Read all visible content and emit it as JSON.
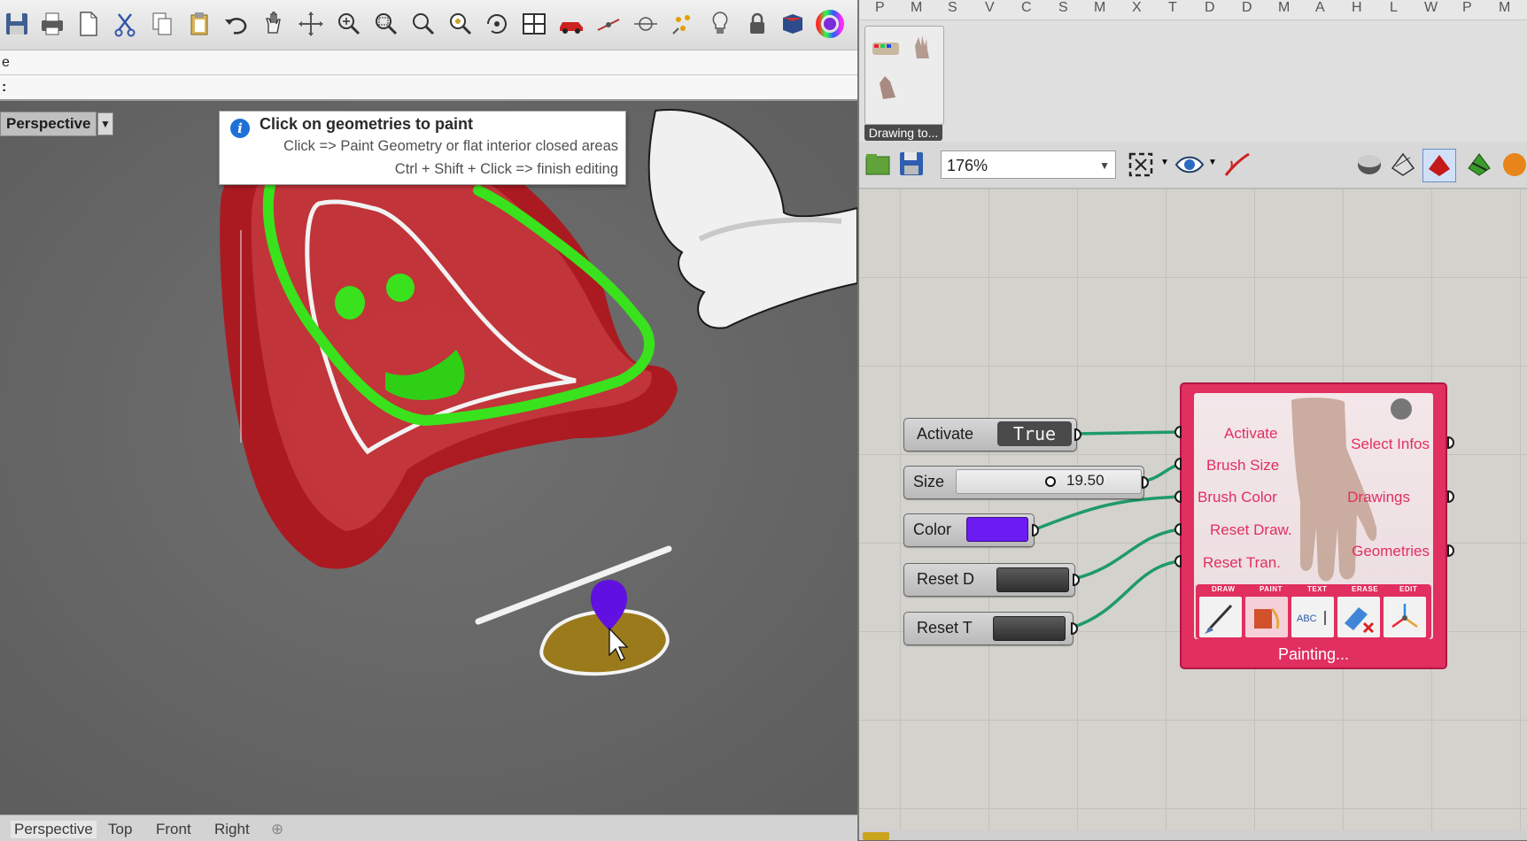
{
  "rhino": {
    "toolbar_icons": [
      "save-icon",
      "print-icon",
      "new-icon",
      "cut-icon",
      "copy-icon",
      "paste-icon",
      "undo-icon",
      "pan-icon",
      "rotate-icon",
      "zoom-icon",
      "zoom-window-icon",
      "zoom-extents-icon",
      "zoom-selected-icon",
      "rotate-view-icon",
      "four-viewports-icon",
      "car-icon",
      "dim-icon",
      "line-icon",
      "points-icon",
      "light-icon",
      "lock-icon",
      "render-icon",
      "color-wheel-icon"
    ],
    "command_history": "e",
    "command_prompt": ":",
    "viewport_name": "Perspective",
    "tooltip": {
      "title": "Click on geometries to paint",
      "line1": "Click => Paint Geometry or flat interior closed areas",
      "line2": "Ctrl + Shift + Click => finish editing"
    },
    "viewport_tabs": [
      "Perspective",
      "Top",
      "Front",
      "Right"
    ],
    "colors": {
      "stroke_green": "#39e21c",
      "stroke_white": "#f2f2f2",
      "marker": "#6010e0",
      "shape_red": "#c2141c"
    }
  },
  "grasshopper": {
    "category_tabs": [
      "P",
      "M",
      "S",
      "V",
      "C",
      "S",
      "M",
      "X",
      "T",
      "D",
      "D",
      "M",
      "A",
      "H",
      "L",
      "W",
      "P",
      "M"
    ],
    "panel_group_label": "Drawing to...",
    "zoom": "176%",
    "components": {
      "activate": {
        "label": "Activate",
        "value": "True"
      },
      "size": {
        "label": "Size",
        "value": "19.50"
      },
      "color": {
        "label": "Color",
        "swatch": "#6d1bf3"
      },
      "reset_d": {
        "label": "Reset D"
      },
      "reset_t": {
        "label": "Reset T"
      }
    },
    "painting_component": {
      "inputs": [
        "Activate",
        "Brush Size",
        "Brush Color",
        "Reset Draw.",
        "Reset Tran."
      ],
      "outputs": [
        "Select Infos",
        "Drawings",
        "Geometries"
      ],
      "tools": [
        "DRAW",
        "PAINT",
        "TEXT",
        "ERASE",
        "EDIT"
      ],
      "status": "Painting...",
      "accent": "#e12f5f"
    },
    "wire_color": "#1f9a6a"
  }
}
